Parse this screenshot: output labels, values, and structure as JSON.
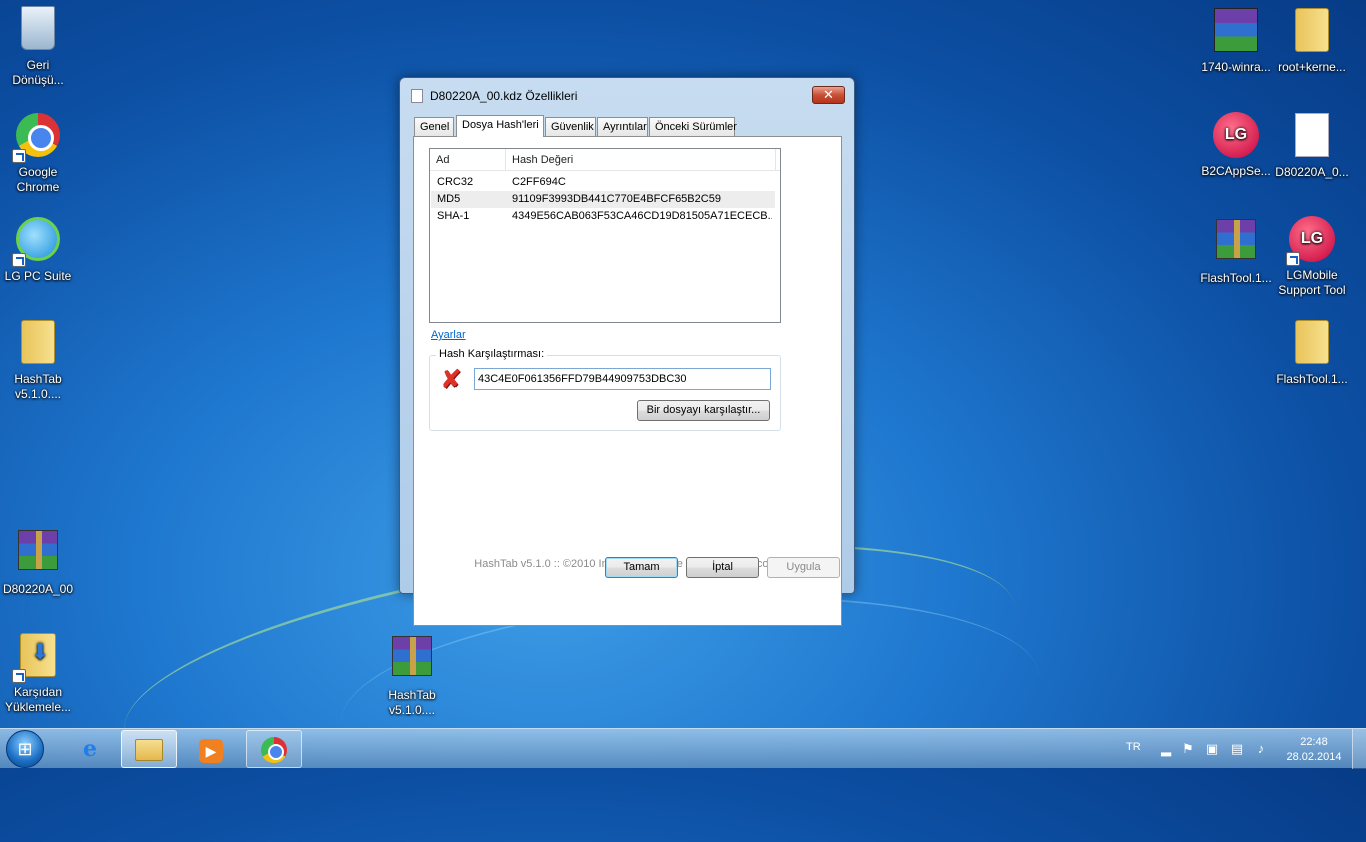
{
  "desktop": {
    "icons_left": [
      {
        "label1": "Geri",
        "label2": "Dönüşü...",
        "icon": "recycle-bin-icon"
      },
      {
        "label1": "Google",
        "label2": "Chrome",
        "icon": "chrome-icon"
      },
      {
        "label1": "LG PC Suite",
        "label2": "",
        "icon": "lg-pc-suite-icon"
      },
      {
        "label1": "HashTab",
        "label2": "v5.1.0....",
        "icon": "folder-icon"
      },
      {
        "label1": "D80220A_00",
        "label2": "",
        "icon": "winrar-archive-icon"
      },
      {
        "label1": "Karşıdan",
        "label2": "Yüklemele...",
        "icon": "downloads-folder-icon"
      }
    ],
    "icons_right": [
      {
        "label1": "1740-winra...",
        "label2": "",
        "icon": "winrar-installer-icon"
      },
      {
        "label1": "root+kerne...",
        "label2": "",
        "icon": "folder-icon"
      },
      {
        "label1": "B2CAppSe...",
        "label2": "",
        "icon": "lg-icon"
      },
      {
        "label1": "D80220A_0...",
        "label2": "",
        "icon": "document-icon"
      },
      {
        "label1": "FlashTool.1...",
        "label2": "",
        "icon": "winrar-archive-icon"
      },
      {
        "label1": "LGMobile",
        "label2": "Support Tool",
        "icon": "lg-icon"
      },
      {
        "label1": "FlashTool.1...",
        "label2": "",
        "icon": "folder-icon"
      }
    ],
    "icon_center": {
      "label1": "HashTab",
      "label2": "v5.1.0....",
      "icon": "winrar-archive-icon"
    }
  },
  "dialog": {
    "title": "D80220A_00.kdz Özellikleri",
    "close_glyph": "✕",
    "tabs": [
      "Genel",
      "Dosya Hash'leri",
      "Güvenlik",
      "Ayrıntılar",
      "Önceki Sürümler"
    ],
    "active_tab_index": 1,
    "hash_table": {
      "columns": [
        "Ad",
        "Hash Değeri"
      ],
      "rows": [
        {
          "name": "CRC32",
          "value": "C2FF694C"
        },
        {
          "name": "MD5",
          "value": "91109F3993DB441C770E4BFCF65B2C59"
        },
        {
          "name": "SHA-1",
          "value": "4349E56CAB063F53CA46CD19D81505A71ECECB..."
        }
      ]
    },
    "settings_link": "Ayarlar",
    "compare_group": {
      "label": "Hash Karşılaştırması:",
      "status_glyph": "✘",
      "input_value": "43C4E0F061356FFD79B44909753DBC30",
      "compare_file_button": "Bir dosyayı karşılaştır..."
    },
    "footer_note": "HashTab v5.1.0 :: ©2010 Implbits Software [http://implbits.com]",
    "buttons": {
      "ok": "Tamam",
      "cancel": "İptal",
      "apply": "Uygula"
    }
  },
  "taskbar": {
    "start_glyph": "⊞",
    "ie_glyph": "e",
    "media_glyph": "▶",
    "language": "TR",
    "time": "22:48",
    "date": "28.02.2014"
  },
  "colors": {
    "accent": "#3c7fb1",
    "link": "#0066cc",
    "error": "#e0302a"
  }
}
